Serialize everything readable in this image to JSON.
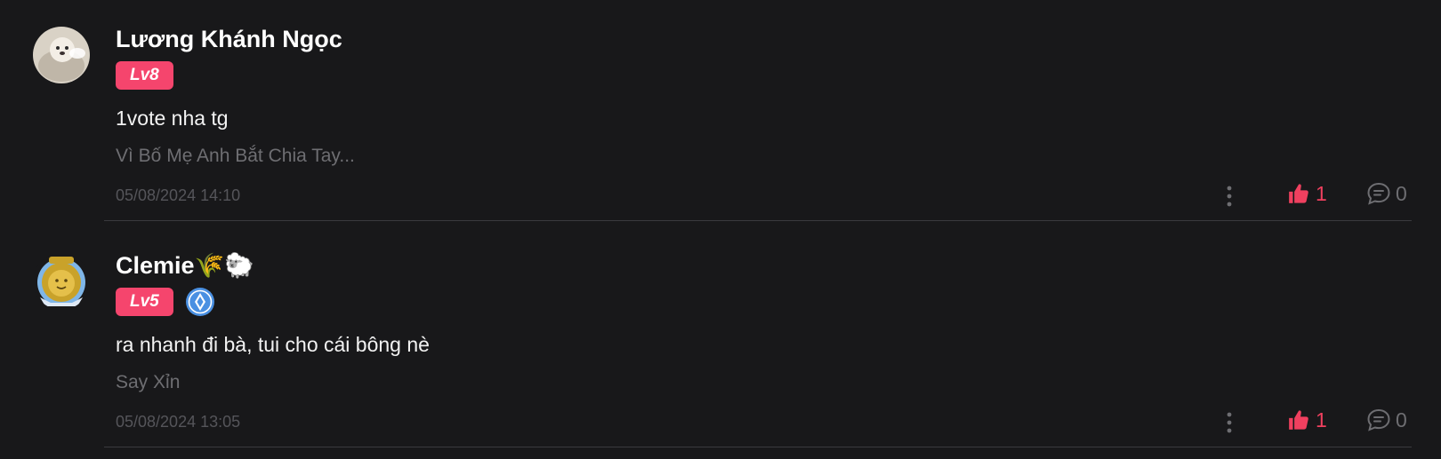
{
  "comments": [
    {
      "author": "Lương Khánh Ngọc",
      "level": "Lv8",
      "has_shield": false,
      "text": "1vote nha tg",
      "story": "Vì Bố Mẹ Anh Bắt Chia Tay...",
      "timestamp": "05/08/2024 14:10",
      "likes": "1",
      "replies": "0",
      "avatar_icon": "cream-dog-avatar"
    },
    {
      "author": "Clemie🌾🐑",
      "level": "Lv5",
      "has_shield": true,
      "text": "ra nhanh đi bà, tui cho cái bông nè",
      "story": "Say Xỉn",
      "timestamp": "05/08/2024 13:05",
      "likes": "1",
      "replies": "0",
      "avatar_icon": "writer-lion-avatar"
    }
  ],
  "colors": {
    "background": "#18181a",
    "level_badge": "#f5456d",
    "like": "#f0405f",
    "muted": "#6e6e72",
    "divider": "#3a3a3e"
  },
  "icons": {
    "more": "vertical-dots-icon",
    "like": "thumbs-up-icon",
    "reply": "chat-bubble-icon",
    "shield": "shield-badge-icon"
  }
}
